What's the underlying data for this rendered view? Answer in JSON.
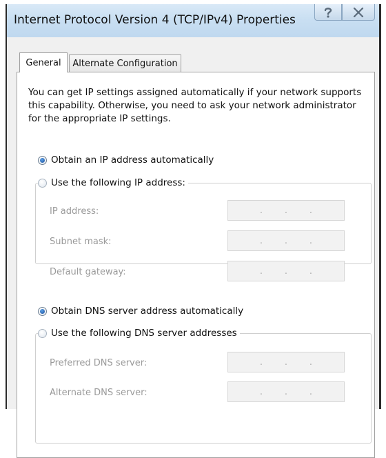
{
  "window": {
    "title": "Internet Protocol Version 4 (TCP/IPv4) Properties",
    "help_icon": "help-question-icon",
    "close_icon": "close-x-icon"
  },
  "tabs": [
    {
      "label": "General",
      "selected": true
    },
    {
      "label": "Alternate Configuration",
      "selected": false
    }
  ],
  "description": "You can get IP settings assigned automatically if your network supports this capability. Otherwise, you need to ask your network administrator for the appropriate IP settings.",
  "ip_settings": {
    "auto_option": {
      "label": "Obtain an IP address automatically",
      "checked": true
    },
    "manual_option": {
      "label": "Use the following IP address:",
      "checked": false
    },
    "fields": [
      {
        "label": "IP address:",
        "value": "",
        "separator": "."
      },
      {
        "label": "Subnet mask:",
        "value": "",
        "separator": "."
      },
      {
        "label": "Default gateway:",
        "value": "",
        "separator": "."
      }
    ]
  },
  "dns_settings": {
    "auto_option": {
      "label": "Obtain DNS server address automatically",
      "checked": true
    },
    "manual_option": {
      "label": "Use the following DNS server addresses",
      "checked": false
    },
    "fields": [
      {
        "label": "Preferred DNS server:",
        "value": "",
        "separator": "."
      },
      {
        "label": "Alternate DNS server:",
        "value": "",
        "separator": "."
      }
    ]
  },
  "colors": {
    "titlebar": "#c9dff2",
    "dialog_background": "#f0f0f0",
    "disabled_text": "#9a9a9a",
    "radio_selected": "#1d4f9c"
  }
}
